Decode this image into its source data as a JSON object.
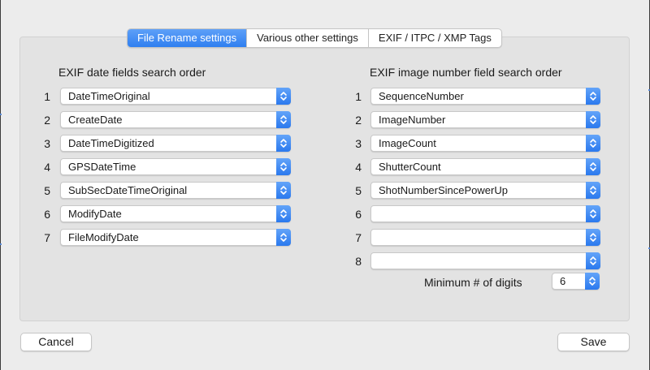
{
  "tabs": [
    {
      "label": "File Rename settings",
      "active": true
    },
    {
      "label": "Various other settings",
      "active": false
    },
    {
      "label": "EXIF / ITPC / XMP Tags",
      "active": false
    }
  ],
  "left_column": {
    "title": "EXIF date fields search order",
    "rows": [
      {
        "num": "1",
        "value": "DateTimeOriginal"
      },
      {
        "num": "2",
        "value": "CreateDate"
      },
      {
        "num": "3",
        "value": "DateTimeDigitized"
      },
      {
        "num": "4",
        "value": "GPSDateTime"
      },
      {
        "num": "5",
        "value": "SubSecDateTimeOriginal"
      },
      {
        "num": "6",
        "value": "ModifyDate"
      },
      {
        "num": "7",
        "value": "FileModifyDate"
      }
    ]
  },
  "right_column": {
    "title": "EXIF image number field search order",
    "rows": [
      {
        "num": "1",
        "value": "SequenceNumber"
      },
      {
        "num": "2",
        "value": "ImageNumber"
      },
      {
        "num": "3",
        "value": "ImageCount"
      },
      {
        "num": "4",
        "value": "ShutterCount"
      },
      {
        "num": "5",
        "value": "ShotNumberSincePowerUp"
      },
      {
        "num": "6",
        "value": ""
      },
      {
        "num": "7",
        "value": ""
      },
      {
        "num": "8",
        "value": ""
      }
    ]
  },
  "min_digits": {
    "label": "Minimum # of digits",
    "value": "6"
  },
  "buttons": {
    "cancel_label": "Cancel",
    "save_label": "Save"
  },
  "colors": {
    "accent": "#2f7ff0",
    "window_bg": "#ececec",
    "panel_bg": "#e3e3e3"
  },
  "icons": {
    "select_arrow": "chevron-up-down-icon"
  }
}
